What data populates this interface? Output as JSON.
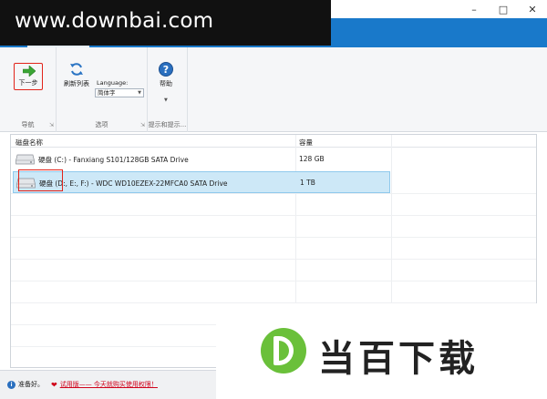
{
  "watermark": {
    "text": "www.downbai.com"
  },
  "window": {
    "minimize_icon": "minimize-icon",
    "maximize_icon": "maximize-icon",
    "close_icon": "close-icon"
  },
  "ribbon": {
    "next_label": "下一步",
    "refresh_label": "刷新列表",
    "language_label": "Language:",
    "language_value": "简体字",
    "help_label": "帮助",
    "group_nav": "导航",
    "group_options": "选项",
    "group_tips": "提示和提示..."
  },
  "list": {
    "columns": {
      "name": "磁盘名称",
      "size": "容量"
    },
    "rows": [
      {
        "name": "硬盘 (C:) - Fanxiang S101/128GB SATA Drive",
        "size": "128 GB",
        "selected": false
      },
      {
        "name": "硬盘 (D:, E:, F:) - WDC WD10EZEX-22MFCA0 SATA Drive",
        "size": "1 TB",
        "selected": true
      }
    ]
  },
  "status": {
    "ready": "准备好。",
    "trial": "试用版—— 今天就购买使用权限！"
  },
  "logo": {
    "text": "当百下载",
    "letter": "D"
  },
  "colors": {
    "ribbon_blue": "#1979ca",
    "highlight_red": "#e2231a",
    "selection": "#cde8f7",
    "logo_green": "#6ac03a"
  }
}
